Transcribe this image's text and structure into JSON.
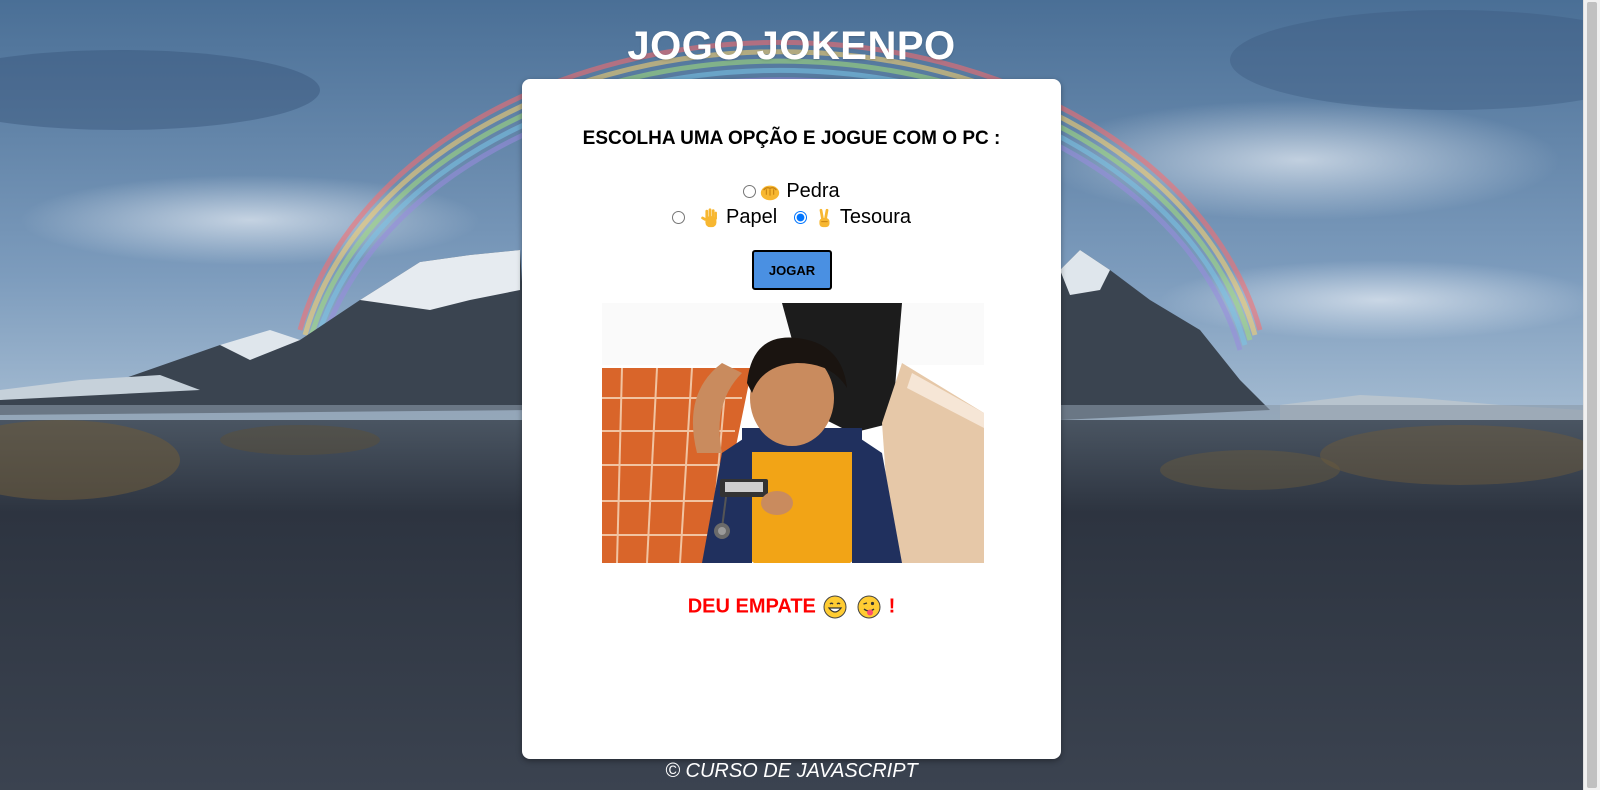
{
  "page": {
    "title": "JOGO JOKENPO",
    "footer": "© CURSO DE JAVASCRIPT"
  },
  "game": {
    "instruction": "ESCOLHA UMA OPÇÃO E JOGUE COM O PC :",
    "options": [
      {
        "label": "Pedra",
        "icon": "fist-icon",
        "checked": false
      },
      {
        "label": "Papel",
        "icon": "raised-hand-icon",
        "checked": false
      },
      {
        "label": "Tesoura",
        "icon": "victory-hand-icon",
        "checked": true
      }
    ],
    "play_button": "JOGAR",
    "result": {
      "text": "DEU EMPATE",
      "icons": [
        "grinning-face-icon",
        "tongue-face-icon"
      ],
      "suffix": "!"
    }
  },
  "colors": {
    "button": "#4a90e2",
    "result": "#ff0000",
    "radio_checked": "#0075ff"
  }
}
